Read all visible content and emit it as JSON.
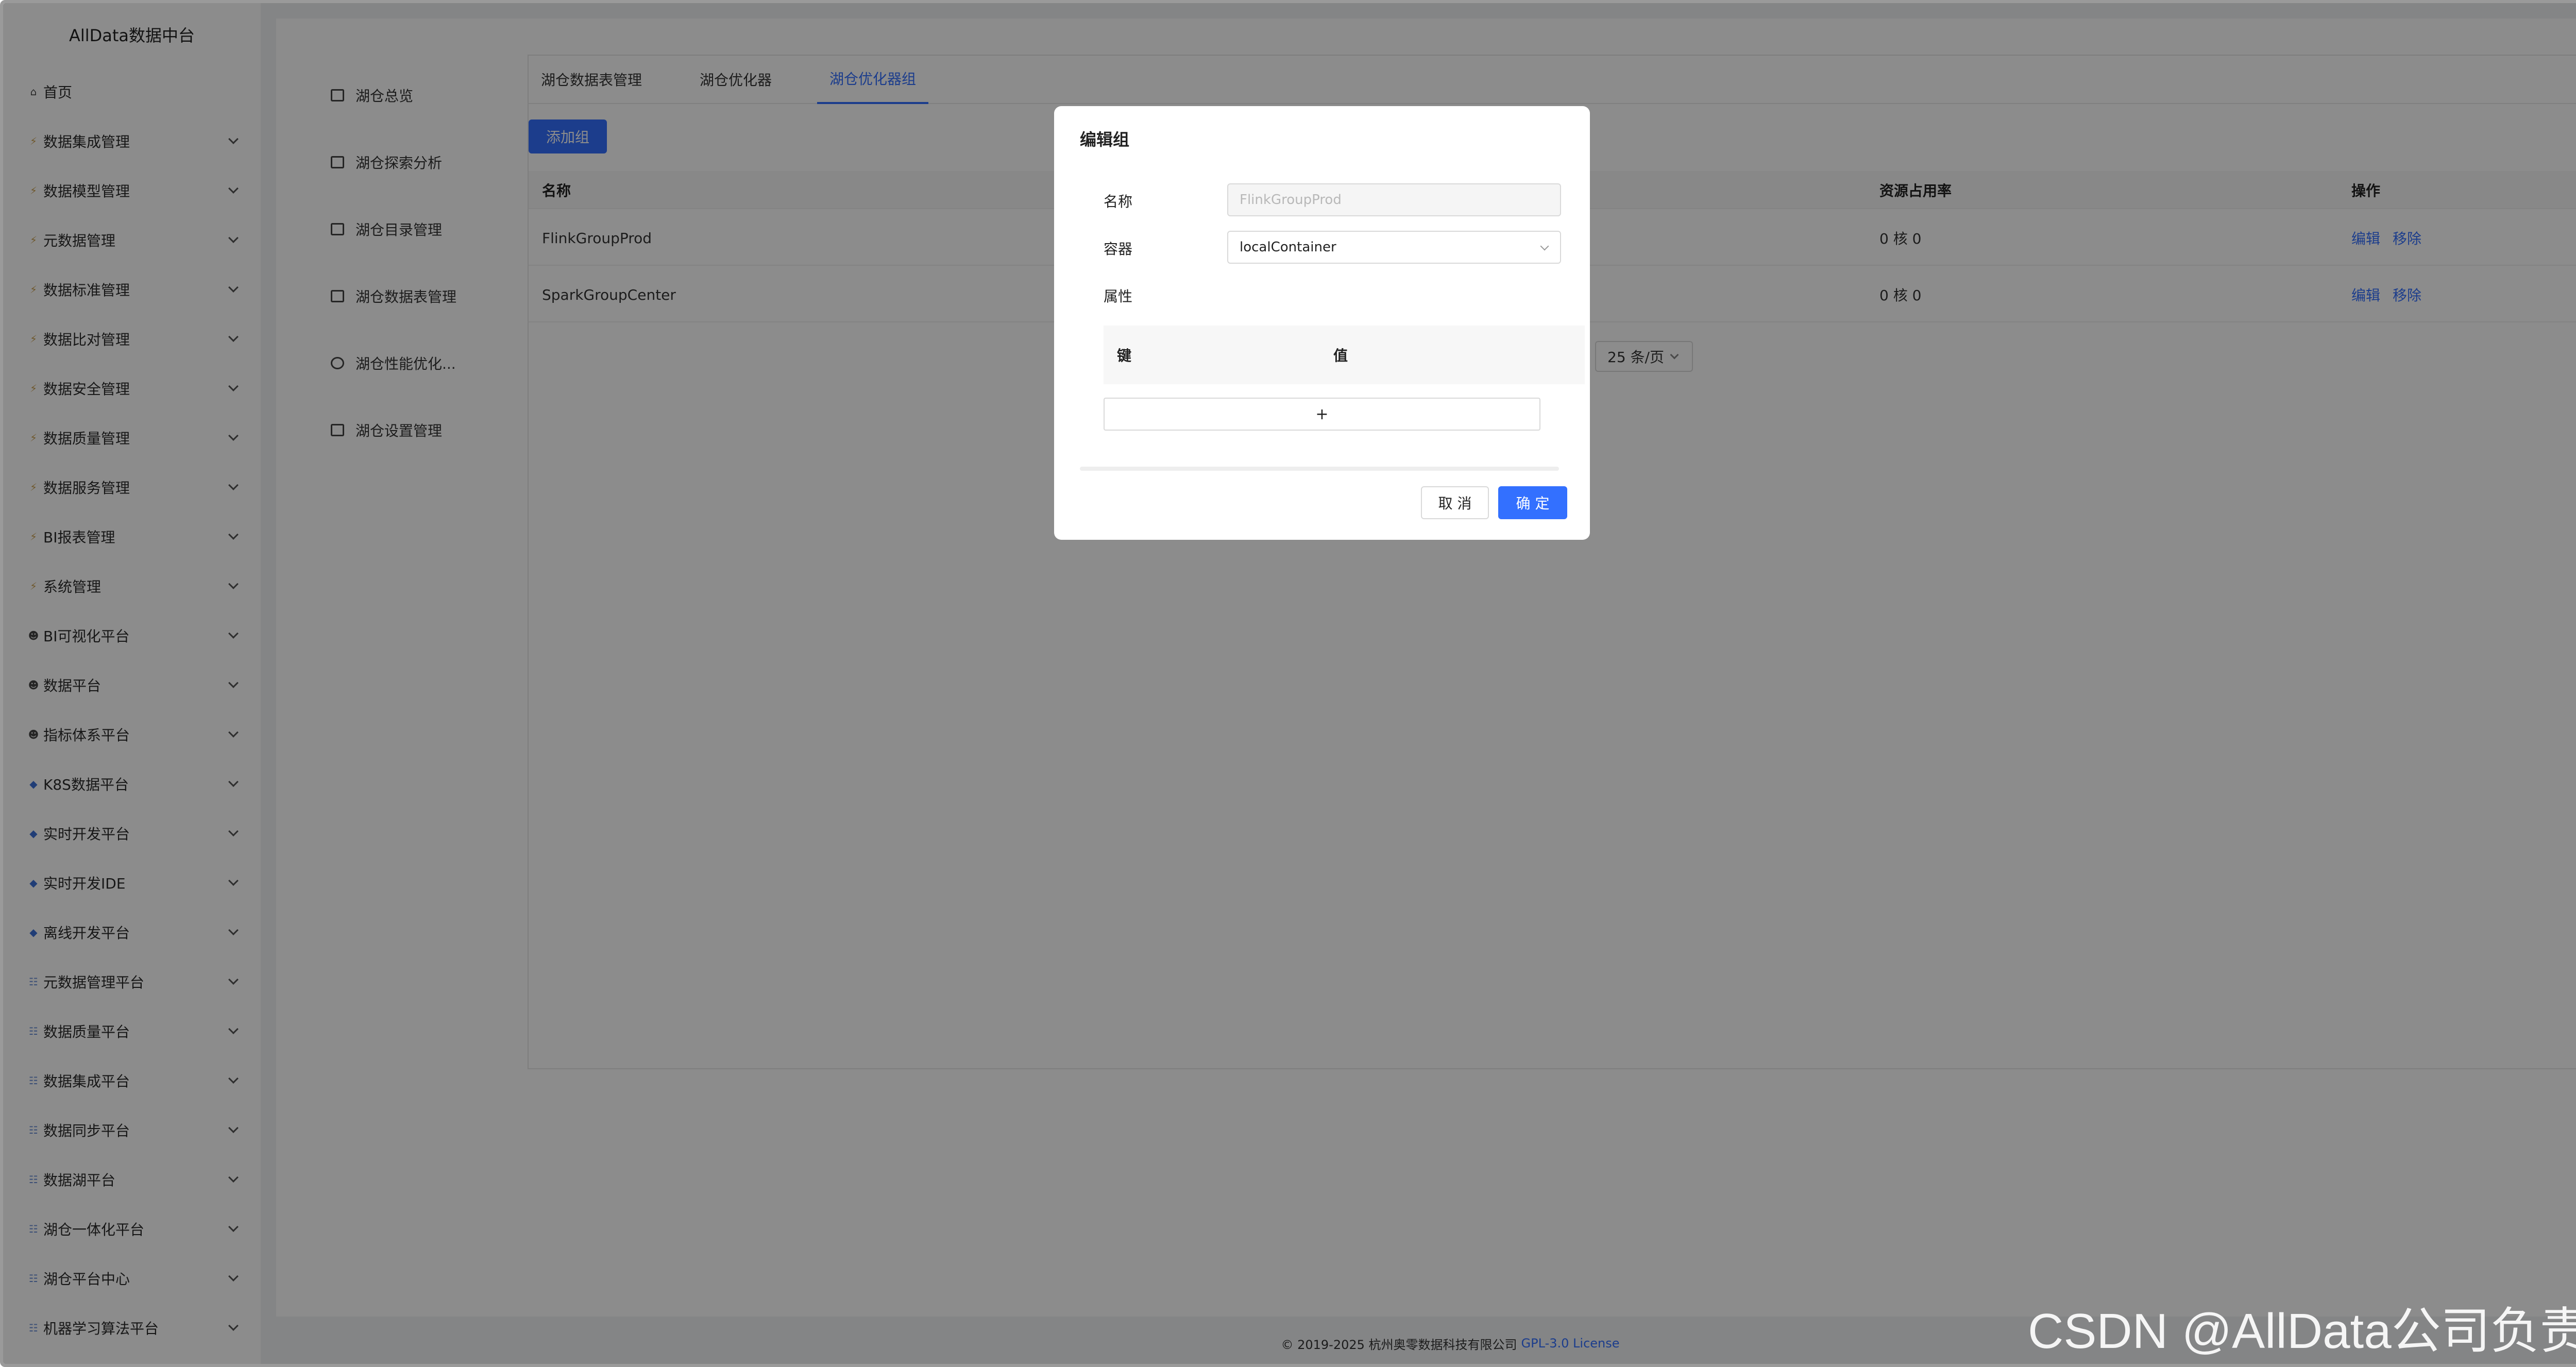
{
  "app": {
    "title": "AllData数据中台"
  },
  "sidebar": {
    "items": [
      {
        "label": "首页",
        "icon": "home-icon",
        "has_chevron": false
      },
      {
        "label": "数据集成管理",
        "icon": "bolt-icon",
        "has_chevron": true
      },
      {
        "label": "数据模型管理",
        "icon": "bolt-icon",
        "has_chevron": true
      },
      {
        "label": "元数据管理",
        "icon": "bolt-icon",
        "has_chevron": true
      },
      {
        "label": "数据标准管理",
        "icon": "bolt-icon",
        "has_chevron": true
      },
      {
        "label": "数据比对管理",
        "icon": "bolt-icon",
        "has_chevron": true
      },
      {
        "label": "数据安全管理",
        "icon": "bolt-icon",
        "has_chevron": true
      },
      {
        "label": "数据质量管理",
        "icon": "bolt-icon",
        "has_chevron": true
      },
      {
        "label": "数据服务管理",
        "icon": "bolt-icon",
        "has_chevron": true
      },
      {
        "label": "BI报表管理",
        "icon": "bolt-icon",
        "has_chevron": true
      },
      {
        "label": "系统管理",
        "icon": "bolt-icon",
        "has_chevron": true
      },
      {
        "label": "BI可视化平台",
        "icon": "person-icon",
        "has_chevron": true
      },
      {
        "label": "数据平台",
        "icon": "person-icon",
        "has_chevron": true
      },
      {
        "label": "指标体系平台",
        "icon": "person-icon",
        "has_chevron": true
      },
      {
        "label": "K8S数据平台",
        "icon": "diamond-icon",
        "has_chevron": true
      },
      {
        "label": "实时开发平台",
        "icon": "diamond-icon",
        "has_chevron": true
      },
      {
        "label": "实时开发IDE",
        "icon": "diamond-icon",
        "has_chevron": true
      },
      {
        "label": "离线开发平台",
        "icon": "diamond-icon",
        "has_chevron": true
      },
      {
        "label": "元数据管理平台",
        "icon": "database-icon",
        "has_chevron": true
      },
      {
        "label": "数据质量平台",
        "icon": "database-icon",
        "has_chevron": true
      },
      {
        "label": "数据集成平台",
        "icon": "database-icon",
        "has_chevron": true
      },
      {
        "label": "数据同步平台",
        "icon": "database-icon",
        "has_chevron": true
      },
      {
        "label": "数据湖平台",
        "icon": "database-icon",
        "has_chevron": true
      },
      {
        "label": "湖仓一体化平台",
        "icon": "database-icon",
        "has_chevron": true
      },
      {
        "label": "湖仓平台中心",
        "icon": "database-icon",
        "has_chevron": true
      },
      {
        "label": "机器学习算法平台",
        "icon": "database-icon",
        "has_chevron": true
      }
    ]
  },
  "subnav": {
    "items": [
      {
        "label": "湖仓总览",
        "icon": "dashboard-icon"
      },
      {
        "label": "湖仓探索分析",
        "icon": "terminal-icon"
      },
      {
        "label": "湖仓目录管理",
        "icon": "catalog-icon"
      },
      {
        "label": "湖仓数据表管理",
        "icon": "table-icon"
      },
      {
        "label": "湖仓性能优化...",
        "icon": "gauge-icon"
      },
      {
        "label": "湖仓设置管理",
        "icon": "monitor-icon"
      }
    ]
  },
  "tabs": {
    "items": [
      "湖仓数据表管理",
      "湖仓优化器",
      "湖仓优化器组"
    ],
    "active": "湖仓优化器组"
  },
  "toolbar": {
    "add_label": "添加组"
  },
  "table": {
    "headers": {
      "name": "名称",
      "usage": "资源占用率",
      "actions": "操作"
    },
    "rows": [
      {
        "name": "FlinkGroupProd",
        "usage": "0 核 0",
        "edit": "编辑",
        "remove": "移除"
      },
      {
        "name": "SparkGroupCenter",
        "usage": "0 核 0",
        "edit": "编辑",
        "remove": "移除"
      }
    ]
  },
  "pager": {
    "page_size": "25 条/页"
  },
  "footer": {
    "copyright": "© 2019-2025 杭州奥零数据科技有限公司",
    "license": "GPL-3.0 License"
  },
  "modal": {
    "title": "编辑组",
    "name_label": "名称",
    "name_value": "FlinkGroupProd",
    "container_label": "容器",
    "container_value": "localContainer",
    "props_label": "属性",
    "key_header": "键",
    "value_header": "值",
    "add_row": "+",
    "cancel": "取 消",
    "ok": "确 定"
  },
  "watermark": "CSDN @AllData公司负责人",
  "colors": {
    "accent": "#3370ff",
    "mask": "rgba(0,0,0,0.45)"
  }
}
